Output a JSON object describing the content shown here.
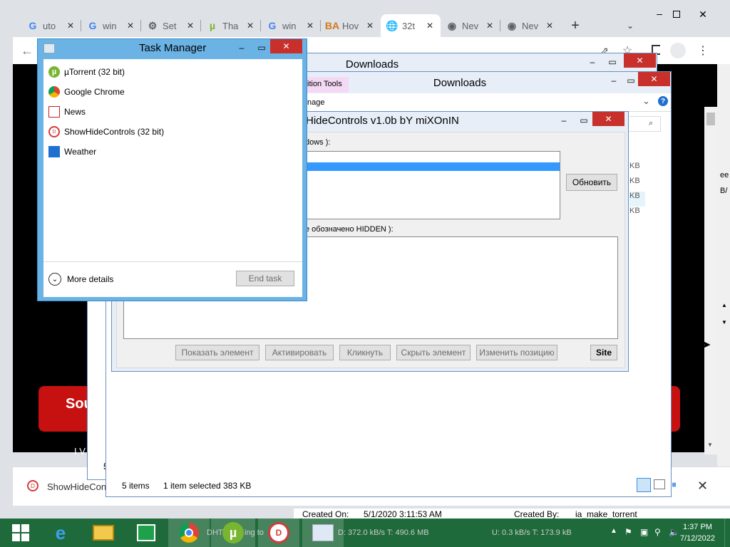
{
  "browser": {
    "tabs": [
      {
        "favicon": "G",
        "title": "uto",
        "color": "#4285f4"
      },
      {
        "favicon": "G",
        "title": "win",
        "color": "#4285f4"
      },
      {
        "favicon": "⚙",
        "title": "Set",
        "color": "#5f6368"
      },
      {
        "favicon": "µ",
        "title": "Tha",
        "color": "#78b530"
      },
      {
        "favicon": "G",
        "title": "win",
        "color": "#4285f4"
      },
      {
        "favicon": "BA",
        "title": "Hov",
        "color": "#d4791a"
      },
      {
        "favicon": "🌐",
        "title": "32t",
        "color": "#5f6368"
      },
      {
        "favicon": "◉",
        "title": "Nev",
        "color": "#5f6368"
      },
      {
        "favicon": "◉",
        "title": "Nev",
        "color": "#5f6368"
      }
    ],
    "page": {
      "red_button_text": "Sou",
      "white_text": "I V"
    },
    "download_item": "ShowHideContro"
  },
  "explorer_back": {
    "title": "Downloads",
    "status_p": "5"
  },
  "explorer": {
    "title": "Downloads",
    "ribbon_tab": "ition Tools",
    "ribbon_sub": "nage",
    "sizes": [
      "KB",
      "KB",
      "KB",
      "KB"
    ],
    "right_clip": [
      "ee",
      "B/"
    ],
    "status": {
      "items": "5 items",
      "selected": "1 item selected  383 KB"
    },
    "details": {
      "created_on_label": "Created On:",
      "created_on_value": "5/1/2020 3:11:53 AM",
      "created_by_label": "Created By:",
      "created_by_value": "ia_make_torrent"
    }
  },
  "shc": {
    "title": "HideControls v1.0b bY miXOnIN",
    "windows_label": "dows ):",
    "hidden_label": "е обозначено HIDDEN  ):",
    "refresh": "Обновить",
    "buttons": [
      "Показать элемент",
      "Активировать",
      "Кликнуть",
      "Скрыть элемент",
      "Изменить позицию",
      "Site"
    ]
  },
  "task_manager": {
    "title": "Task Manager",
    "apps": [
      {
        "name": "µTorrent (32 bit)",
        "icon": "utorrent-icon"
      },
      {
        "name": "Google Chrome",
        "icon": "chrome-icon"
      },
      {
        "name": "News",
        "icon": "news-icon"
      },
      {
        "name": "ShowHideControls (32 bit)",
        "icon": "showhide-icon"
      },
      {
        "name": "Weather",
        "icon": "weather-icon"
      }
    ],
    "more_details": "More details",
    "end_task": "End task"
  },
  "taskbar": {
    "torrent_status_1": "DHT",
    "torrent_status_2": "ing to",
    "torrent_dl": "D: 372.0 kB/s T: 490.6 MB",
    "torrent_ul": "U: 0.3 kB/s T: 173.9 kB",
    "time": "1:37 PM",
    "date": "7/12/2022"
  }
}
